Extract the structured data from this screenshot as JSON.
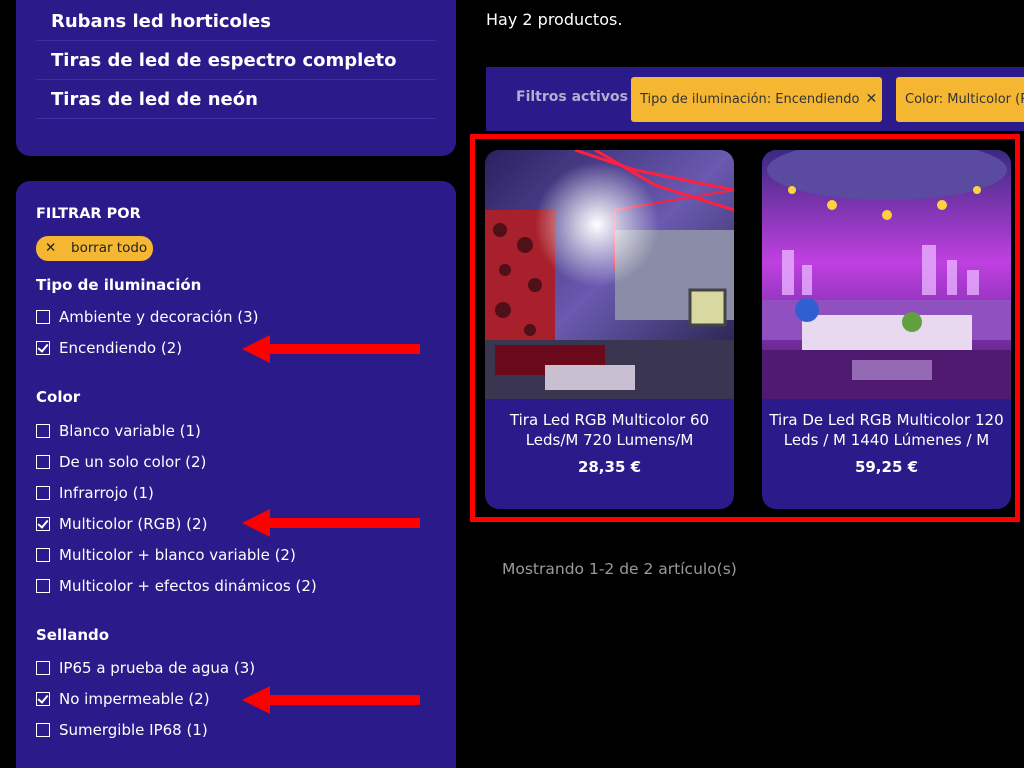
{
  "categories": [
    {
      "label": "Rubans led horticoles"
    },
    {
      "label": "Tiras de led de espectro completo"
    },
    {
      "label": "Tiras de led de neón"
    }
  ],
  "filters": {
    "title": "FILTRAR POR",
    "clear_label": "borrar todo",
    "facets": [
      {
        "title": "Tipo de iluminación",
        "options": [
          {
            "label": "Ambiente y decoración (3)",
            "checked": false
          },
          {
            "label": "Encendiendo (2)",
            "checked": true
          }
        ]
      },
      {
        "title": "Color",
        "options": [
          {
            "label": "Blanco variable (1)",
            "checked": false
          },
          {
            "label": "De un solo color (2)",
            "checked": false
          },
          {
            "label": "Infrarrojo (1)",
            "checked": false
          },
          {
            "label": "Multicolor (RGB) (2)",
            "checked": true
          },
          {
            "label": "Multicolor + blanco variable (2)",
            "checked": false
          },
          {
            "label": "Multicolor + efectos dinámicos (2)",
            "checked": false
          }
        ]
      },
      {
        "title": "Sellando",
        "options": [
          {
            "label": "IP65 a prueba de agua (3)",
            "checked": false
          },
          {
            "label": "No impermeable (2)",
            "checked": true
          },
          {
            "label": "Sumergible IP68 (1)",
            "checked": false
          }
        ]
      }
    ]
  },
  "results": {
    "count_text": "Hay 2 productos.",
    "active_filters_label": "Filtros activos",
    "active_filters": [
      {
        "label": "Tipo de iluminación: Encendiendo"
      },
      {
        "label": "Color: Multicolor (R"
      }
    ],
    "products": [
      {
        "name": "Tira Led RGB Multicolor 60 Leds/M 720 Lumens/M",
        "price": "28,35 €"
      },
      {
        "name": "Tira De Led RGB Multicolor 120 Leds / M 1440 Lúmenes / M",
        "price": "59,25 €"
      }
    ],
    "pagination": "Mostrando 1-2 de 2 artículo(s)"
  },
  "colors": {
    "panel": "#2a1a8a",
    "accent": "#f5b731",
    "annotation": "#ff0000",
    "background": "#000000"
  }
}
